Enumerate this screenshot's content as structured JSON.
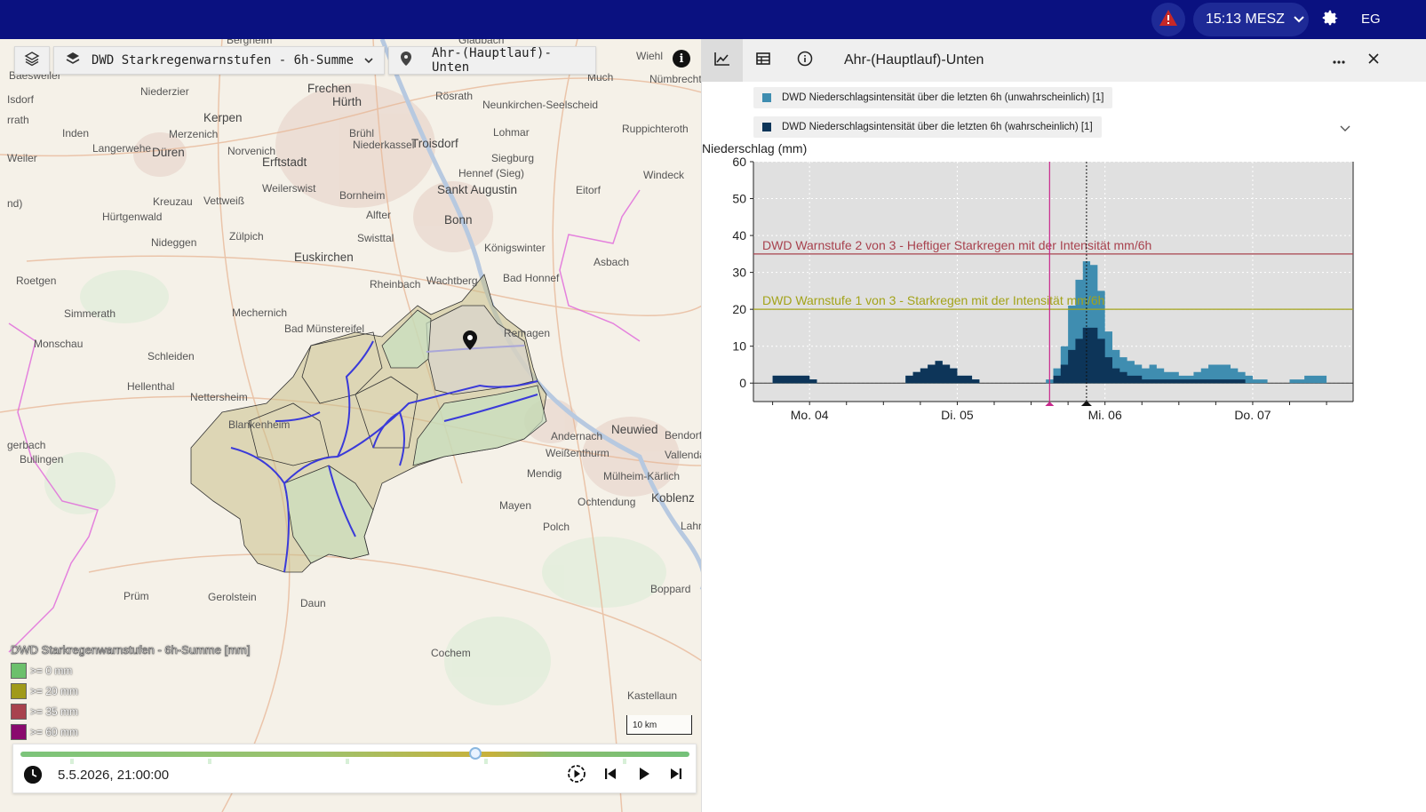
{
  "topbar": {
    "time_label": "15:13 MESZ",
    "user_initials": "EG"
  },
  "map": {
    "layer_selector": "DWD Starkregenwarnstufen - 6h-Summe",
    "location_selector": "Ahr-(Hauptlauf)-Unten",
    "info_label": "i",
    "places": [
      {
        "name": "Bergheim",
        "big": false
      },
      {
        "name": "Gladbach",
        "big": false
      },
      {
        "name": "Wiehl",
        "big": false
      },
      {
        "name": "Much",
        "big": false
      },
      {
        "name": "Baesweiler",
        "big": false
      },
      {
        "name": "Niederzier",
        "big": false
      },
      {
        "name": "Frechen",
        "big": true
      },
      {
        "name": "Hürth",
        "big": true
      },
      {
        "name": "Rösrath",
        "big": false
      },
      {
        "name": "Neunkirchen-Seelscheid",
        "big": false
      },
      {
        "name": "Nümbrecht",
        "big": false
      },
      {
        "name": "Kerpen",
        "big": true
      },
      {
        "name": "Inden",
        "big": false
      },
      {
        "name": "Merzenich",
        "big": false
      },
      {
        "name": "Brühl",
        "big": false
      },
      {
        "name": "Lohmar",
        "big": false
      },
      {
        "name": "Ruppichteroth",
        "big": false
      },
      {
        "name": "Langerwehe",
        "big": false
      },
      {
        "name": "Düren",
        "big": true
      },
      {
        "name": "Norvenich",
        "big": false
      },
      {
        "name": "Niederkassel",
        "big": false
      },
      {
        "name": "Troisdorf",
        "big": true
      },
      {
        "name": "Erftstadt",
        "big": true
      },
      {
        "name": "Siegburg",
        "big": false
      },
      {
        "name": "Hennef (Sieg)",
        "big": false
      },
      {
        "name": "Windeck",
        "big": false
      },
      {
        "name": "Weilerswist",
        "big": false
      },
      {
        "name": "Sankt Augustin",
        "big": true
      },
      {
        "name": "Eitorf",
        "big": false
      },
      {
        "name": "Kreuzau",
        "big": false
      },
      {
        "name": "Vettweiß",
        "big": false
      },
      {
        "name": "Bornheim",
        "big": false
      },
      {
        "name": "Alfter",
        "big": false
      },
      {
        "name": "Hürtgenwald",
        "big": false
      },
      {
        "name": "Bonn",
        "big": true
      },
      {
        "name": "Zülpich",
        "big": false
      },
      {
        "name": "Swisttal",
        "big": false
      },
      {
        "name": "Königswinter",
        "big": false
      },
      {
        "name": "Nideggen",
        "big": false
      },
      {
        "name": "Euskirchen",
        "big": true
      },
      {
        "name": "Asbach",
        "big": false
      },
      {
        "name": "Roetgen",
        "big": false
      },
      {
        "name": "Rheinbach",
        "big": false
      },
      {
        "name": "Wachtberg",
        "big": false
      },
      {
        "name": "Bad Honnef",
        "big": false
      },
      {
        "name": "Simmerath",
        "big": false
      },
      {
        "name": "Mechernich",
        "big": false
      },
      {
        "name": "Bad Münstereifel",
        "big": false
      },
      {
        "name": "Remagen",
        "big": false
      },
      {
        "name": "Monschau",
        "big": false
      },
      {
        "name": "Schleiden",
        "big": false
      },
      {
        "name": "Hellenthal",
        "big": false
      },
      {
        "name": "Nettersheim",
        "big": false
      },
      {
        "name": "Neuwied",
        "big": true
      },
      {
        "name": "Andernach",
        "big": false
      },
      {
        "name": "Bendorf",
        "big": false
      },
      {
        "name": "Blankenheim",
        "big": false
      },
      {
        "name": "Weißenthurm",
        "big": false
      },
      {
        "name": "Vallenda",
        "big": false
      },
      {
        "name": "Mendig",
        "big": false
      },
      {
        "name": "Bullingen",
        "big": false
      },
      {
        "name": "Mülheim-Kärlich",
        "big": false
      },
      {
        "name": "Koblenz",
        "big": true
      },
      {
        "name": "Ochtendung",
        "big": false
      },
      {
        "name": "Mayen",
        "big": false
      },
      {
        "name": "Lahr",
        "big": false
      },
      {
        "name": "Polch",
        "big": false
      },
      {
        "name": "Prüm",
        "big": false
      },
      {
        "name": "Gerolstein",
        "big": false
      },
      {
        "name": "Boppard",
        "big": false
      },
      {
        "name": "Daun",
        "big": false
      },
      {
        "name": "Cochem",
        "big": false
      },
      {
        "name": "Kastellaun",
        "big": false
      },
      {
        "name": "Weiler",
        "big": false
      },
      {
        "name": "Isdorf",
        "big": false
      },
      {
        "name": "rrath",
        "big": false
      },
      {
        "name": "nd)",
        "big": false
      },
      {
        "name": "gerbach",
        "big": false
      }
    ],
    "legend": {
      "title": "DWD Starkregenwarnstufen - 6h-Summe [mm]",
      "items": [
        {
          "label": ">= 0 mm",
          "color": "#6cc06c"
        },
        {
          "label": ">= 20 mm",
          "color": "#a09a1a"
        },
        {
          "label": ">= 35 mm",
          "color": "#a8424e"
        },
        {
          "label": ">= 60 mm",
          "color": "#8a0a6e"
        }
      ]
    },
    "scale_label": "10 km"
  },
  "timeline": {
    "datetime": "5.5.2026, 21:00:00",
    "progress": 0.68
  },
  "panel": {
    "title": "Ahr-(Hauptlauf)-Unten",
    "series_chips": [
      {
        "label": "DWD Niederschlagsintensität über die letzten 6h (unwahrscheinlich) [1]",
        "color": "#3f8db0"
      },
      {
        "label": "DWD Niederschlagsintensität über die letzten 6h (wahrscheinlich) [1]",
        "color": "#0d3559"
      }
    ]
  },
  "chart_data": {
    "type": "area",
    "ylabel": "Niederschlag (mm)",
    "ylim": [
      -5,
      60
    ],
    "yticks": [
      0,
      10,
      20,
      30,
      40,
      50,
      60
    ],
    "x_tick_labels": [
      "Mo. 04",
      "Di. 05",
      "Mi. 06",
      "Do. 07"
    ],
    "x_range_days": [
      3.62,
      7.68
    ],
    "grid": true,
    "now_day": 5.625,
    "selected_day": 5.875,
    "thresholds": [
      {
        "label": "DWD Warnstufe 2 von 3 - Heftiger Starkregen mit der Intensität mm/6h",
        "value": 35,
        "color": "#a8424e"
      },
      {
        "label": "DWD Warnstufe 1 von 3 - Starkregen mit der Intensität mm/6h",
        "value": 20,
        "color": "#a3a31a"
      }
    ],
    "x_days": [
      3.7,
      3.75,
      3.85,
      3.95,
      4.0,
      4.05,
      4.6,
      4.65,
      4.7,
      4.75,
      4.8,
      4.85,
      4.9,
      4.95,
      5.0,
      5.1,
      5.15,
      5.55,
      5.6,
      5.65,
      5.7,
      5.75,
      5.8,
      5.85,
      5.9,
      5.95,
      6.0,
      6.05,
      6.1,
      6.15,
      6.2,
      6.25,
      6.3,
      6.35,
      6.4,
      6.45,
      6.5,
      6.55,
      6.6,
      6.65,
      6.7,
      6.75,
      6.8,
      6.85,
      6.9,
      6.95,
      7.0,
      7.05,
      7.1,
      7.15,
      7.2,
      7.25,
      7.3,
      7.35,
      7.4,
      7.45,
      7.5
    ],
    "series": [
      {
        "name": "DWD Niederschlagsintensität über die letzten 6h (unwahrscheinlich) [1]",
        "color": "#3f8db0",
        "values": [
          0,
          2,
          2,
          2,
          1,
          0,
          0,
          2,
          3,
          4,
          5,
          6,
          5,
          4,
          2,
          1,
          0,
          0,
          1,
          4,
          10,
          21,
          28,
          33,
          32,
          25,
          14,
          9,
          7,
          6,
          5,
          4,
          5,
          4,
          3,
          3,
          2,
          2,
          3,
          4,
          5,
          5,
          5,
          4,
          3,
          2,
          1,
          1,
          0,
          0,
          0,
          1,
          1,
          2,
          2,
          2,
          0
        ]
      },
      {
        "name": "DWD Niederschlagsintensität über die letzten 6h (wahrscheinlich) [1]",
        "color": "#0d3559",
        "values": [
          0,
          2,
          2,
          2,
          1,
          0,
          0,
          2,
          3,
          4,
          5,
          6,
          5,
          4,
          2,
          1,
          0,
          0,
          0,
          2,
          5,
          9,
          12,
          15,
          15,
          12,
          7,
          4,
          3,
          2,
          2,
          1,
          1,
          1,
          1,
          1,
          1,
          1,
          1,
          1,
          1,
          1,
          1,
          1,
          1,
          0,
          0,
          0,
          0,
          0,
          0,
          0,
          0,
          0,
          0,
          0,
          0
        ]
      }
    ]
  }
}
